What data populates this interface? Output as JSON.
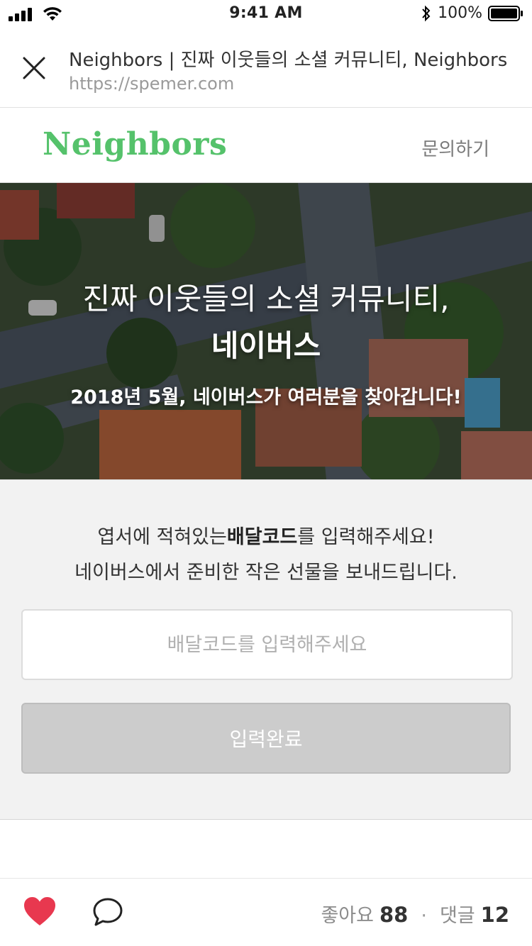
{
  "status_bar": {
    "time": "9:41 AM",
    "battery": "100%"
  },
  "browser": {
    "title": "Neighbors | 진짜 이웃들의 소셜 커뮤니티, Neighbors",
    "url": "https://spemer.com"
  },
  "nav": {
    "logo": "Neighbors",
    "contact": "문의하기",
    "brand_color": "#55c26b"
  },
  "hero": {
    "title": "진짜 이웃들의 소셜 커뮤니티,",
    "brand": "네이버스",
    "subtitle": "2018년 5월, 네이버스가 여러분을 찾아갑니다!"
  },
  "form": {
    "line1_before": "엽서에 적혀있는",
    "line1_bold": "배달코드",
    "line1_after": "를 입력해주세요!",
    "line2": "네이버스에서 준비한 작은 선물을 보내드립니다.",
    "input_placeholder": "배달코드를 입력해주세요",
    "input_value": "",
    "submit_label": "입력완료"
  },
  "bottom_bar": {
    "likes_label": "좋아요",
    "likes_count": "88",
    "separator": "·",
    "comments_label": "댓글",
    "comments_count": "12",
    "like_color": "#e8384f"
  }
}
